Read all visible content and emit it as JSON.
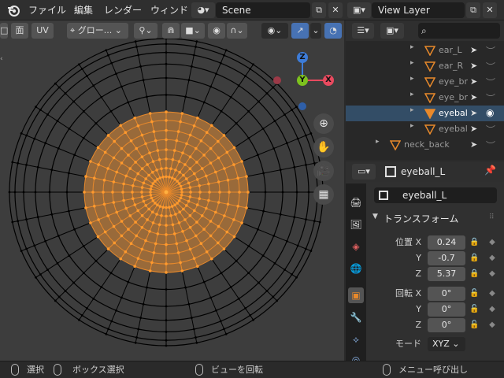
{
  "topbar": {
    "menus": [
      "ファイル",
      "編集",
      "レンダー",
      "ウィンド"
    ],
    "scene": "Scene",
    "view_layer": "View Layer"
  },
  "viewport": {
    "select_buttons": [
      "面",
      "UV"
    ],
    "transform_orientation": "グロー...",
    "gizmo_axes": [
      "Z",
      "Y",
      "X"
    ]
  },
  "outliner": {
    "rows": [
      {
        "label": "ear_L",
        "selected": false
      },
      {
        "label": "ear_R",
        "selected": false
      },
      {
        "label": "eye_br",
        "selected": false
      },
      {
        "label": "eye_br",
        "selected": false
      },
      {
        "label": "eyebal",
        "selected": true
      },
      {
        "label": "eyebal",
        "selected": false
      },
      {
        "label": "neck_back",
        "selected": false
      }
    ]
  },
  "properties": {
    "header_object": "eyeball_L",
    "object_name": "eyeball_L",
    "panel_title": "トランスフォーム",
    "location_label": "位置",
    "rotation_label": "回転",
    "mode_label": "モード",
    "axes": [
      "X",
      "Y",
      "Z"
    ],
    "location": [
      "0.24",
      "-0.7",
      "5.37"
    ],
    "rotation": [
      "0°",
      "0°",
      "0°"
    ],
    "rotation_mode": "XYZ"
  },
  "statusbar": {
    "select": "選択",
    "box_select": "ボックス選択",
    "rotate_view": "ビューを回転",
    "call_menu": "メニュー呼び出し"
  },
  "colors": {
    "selection_orange": "#e8892b",
    "accent_blue": "#4772b3",
    "axis_x": "#e84a5f",
    "axis_y": "#7dc21e",
    "axis_z": "#3d7cd8"
  }
}
